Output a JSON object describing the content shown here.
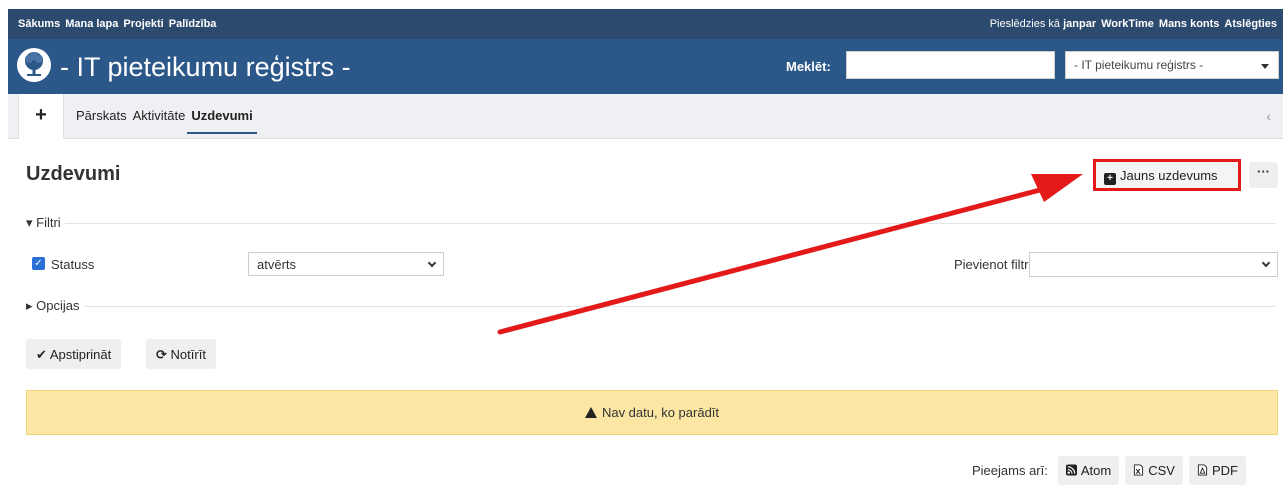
{
  "top_menu": {
    "items": [
      "Sākums",
      "Mana lapa",
      "Projekti",
      "Palīdzība"
    ],
    "logged_in_prefix": "Pieslēdzies kā",
    "username": "janpar",
    "right_items": [
      "WorkTime",
      "Mans konts",
      "Atslēgties"
    ]
  },
  "header": {
    "title": "- IT pieteikumu reģistrs -",
    "search_label": "Meklēt:",
    "search_value": "",
    "project_jump_value": "- IT pieteikumu reģistrs -"
  },
  "tabs": {
    "new_object": "+",
    "items": [
      "Pārskats",
      "Aktivitāte",
      "Uzdevumi"
    ],
    "selected": "Uzdevumi",
    "scroll_icon": "‹"
  },
  "main": {
    "title": "Uzdevumi",
    "new_issue_label": "Jauns uzdevums",
    "more_label": "···",
    "filters_legend": "▾ Filtri",
    "status_label": "Statuss",
    "status_value": "atvērts",
    "add_filter_label": "Pievienot filtru",
    "add_filter_value": "",
    "options_legend": "▸ Opcijas",
    "apply_label": "Apstiprināt",
    "clear_label": "Notīrīt",
    "no_data": "Nav datu, ko parādīt",
    "also_available": "Pieejams arī:",
    "formats": [
      "Atom",
      "CSV",
      "PDF"
    ]
  },
  "colors": {
    "top_bar": "#2c4a6e",
    "header": "#2c5789",
    "highlight_box": "#e41a1a",
    "warning_bg": "#fbe7a3",
    "checkbox": "#2a6fd6"
  },
  "icons": {
    "logo": "tree-logo-icon",
    "new_issue": "plus-square-icon",
    "apply": "check-icon",
    "clear": "refresh-icon",
    "warning": "warning-triangle-icon",
    "atom": "feed-icon",
    "csv": "file-csv-icon",
    "pdf": "file-pdf-icon"
  }
}
